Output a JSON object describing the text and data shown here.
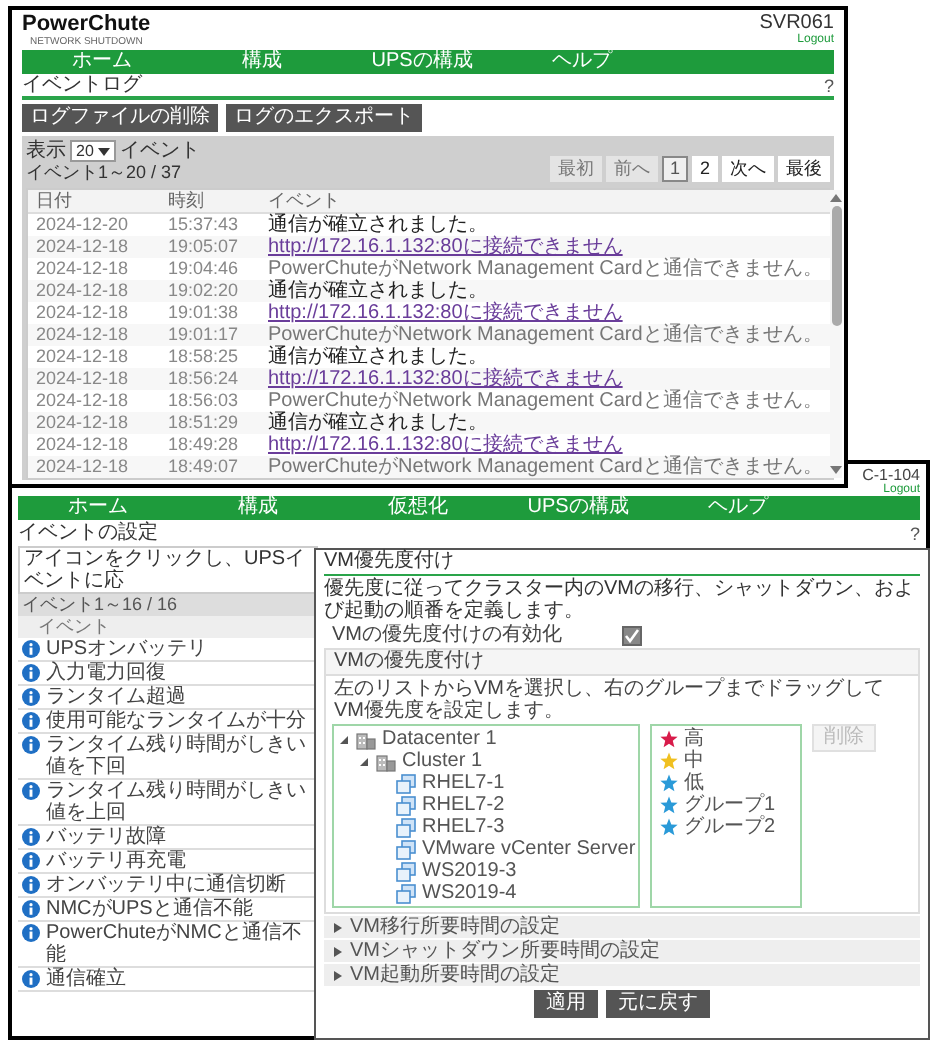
{
  "event_log_window": {
    "logo": "PowerChute",
    "logo_subtitle": "NETWORK SHUTDOWN",
    "host": "SVR061",
    "logout": "Logout",
    "nav": [
      "ホーム",
      "構成",
      "UPSの構成",
      "ヘルプ"
    ],
    "title": "イベントログ",
    "help": "?",
    "buttons": [
      "ログファイルの削除",
      "ログのエクスポート"
    ],
    "show_label": "表示",
    "show_value": "20",
    "show_suffix": "イベント",
    "range": "イベント1～20 / 37",
    "pagination": [
      {
        "label": "最初",
        "selected": false,
        "disabled": true
      },
      {
        "label": "前へ",
        "selected": false,
        "disabled": true
      },
      {
        "label": "1",
        "selected": true,
        "disabled": false
      },
      {
        "label": "2",
        "selected": false,
        "disabled": false
      },
      {
        "label": "次へ",
        "selected": false,
        "disabled": false
      },
      {
        "label": "最後",
        "selected": false,
        "disabled": false
      }
    ],
    "table": {
      "columns": [
        "日付",
        "時刻",
        "イベント"
      ],
      "rows": [
        {
          "date": "2024-12-20",
          "time": "15:37:43",
          "event": "通信が確立されました。",
          "kind": "strong"
        },
        {
          "date": "2024-12-18",
          "time": "19:05:07",
          "event": "http://172.16.1.132:80に接続できません",
          "kind": "link"
        },
        {
          "date": "2024-12-18",
          "time": "19:04:46",
          "event": "PowerChuteがNetwork Management Cardと通信できません。",
          "kind": "plain"
        },
        {
          "date": "2024-12-18",
          "time": "19:02:20",
          "event": "通信が確立されました。",
          "kind": "strong"
        },
        {
          "date": "2024-12-18",
          "time": "19:01:38",
          "event": "http://172.16.1.132:80に接続できません",
          "kind": "link"
        },
        {
          "date": "2024-12-18",
          "time": "19:01:17",
          "event": "PowerChuteがNetwork Management Cardと通信できません。",
          "kind": "plain"
        },
        {
          "date": "2024-12-18",
          "time": "18:58:25",
          "event": "通信が確立されました。",
          "kind": "strong"
        },
        {
          "date": "2024-12-18",
          "time": "18:56:24",
          "event": "http://172.16.1.132:80に接続できません",
          "kind": "link"
        },
        {
          "date": "2024-12-18",
          "time": "18:56:03",
          "event": "PowerChuteがNetwork Management Cardと通信できません。",
          "kind": "plain"
        },
        {
          "date": "2024-12-18",
          "time": "18:51:29",
          "event": "通信が確立されました。",
          "kind": "strong"
        },
        {
          "date": "2024-12-18",
          "time": "18:49:28",
          "event": "http://172.16.1.132:80に接続できません",
          "kind": "link"
        },
        {
          "date": "2024-12-18",
          "time": "18:49:07",
          "event": "PowerChuteがNetwork Management Cardと通信できません。",
          "kind": "plain"
        }
      ]
    }
  },
  "event_settings_window": {
    "host": "C-1-104",
    "logout": "Logout",
    "nav": [
      "ホーム",
      "構成",
      "仮想化",
      "UPSの構成",
      "ヘルプ"
    ],
    "title": "イベントの設定",
    "help": "?",
    "instruction": "アイコンをクリックし、UPSイベントに応",
    "range": "イベント1～16 / 16",
    "list_header": "イベント",
    "events": [
      "UPSオンバッテリ",
      "入力電力回復",
      "ランタイム超過",
      "使用可能なランタイムが十分",
      "ランタイム残り時間がしきい値を下回",
      "ランタイム残り時間がしきい値を上回",
      "バッテリ故障",
      "バッテリ再充電",
      "オンバッテリ中に通信切断",
      "NMCがUPSと通信不能",
      "PowerChuteがNMCと通信不能",
      "通信確立"
    ]
  },
  "vm_priority_window": {
    "title": "VM優先度付け",
    "description": "優先度に従ってクラスター内のVMの移行、シャットダウン、および起動の順番を定義します。",
    "enable_label": "VMの優先度付けの有効化",
    "enable_checked": true,
    "panel_title": "VMの優先度付け",
    "panel_instruction": "左のリストからVMを選択し、右のグループまでドラッグしてVM優先度を設定します。",
    "tree": [
      {
        "label": "Datacenter 1",
        "kind": "datacenter",
        "expanded": true,
        "children": [
          {
            "label": "Cluster 1",
            "kind": "cluster",
            "expanded": true,
            "children": [
              {
                "label": "RHEL7-1",
                "kind": "vm"
              },
              {
                "label": "RHEL7-2",
                "kind": "vm"
              },
              {
                "label": "RHEL7-3",
                "kind": "vm"
              },
              {
                "label": "VMware vCenter Server",
                "kind": "vm"
              },
              {
                "label": "WS2019-3",
                "kind": "vm"
              },
              {
                "label": "WS2019-4",
                "kind": "vm"
              }
            ]
          }
        ]
      }
    ],
    "groups": [
      {
        "label": "高",
        "color": "#d81b4a"
      },
      {
        "label": "中",
        "color": "#f0c020"
      },
      {
        "label": "低",
        "color": "#2a9ad8"
      },
      {
        "label": "グループ1",
        "color": "#2a9ad8"
      },
      {
        "label": "グループ2",
        "color": "#2a9ad8"
      }
    ],
    "delete_button": {
      "label": "削除",
      "disabled": true
    },
    "sections": [
      {
        "label": "VM移行所要時間の設定",
        "expanded": false
      },
      {
        "label": "VMシャットダウン所要時間の設定",
        "expanded": false
      },
      {
        "label": "VM起動所要時間の設定",
        "expanded": false
      }
    ],
    "buttons": [
      "適用",
      "元に戻す"
    ]
  }
}
